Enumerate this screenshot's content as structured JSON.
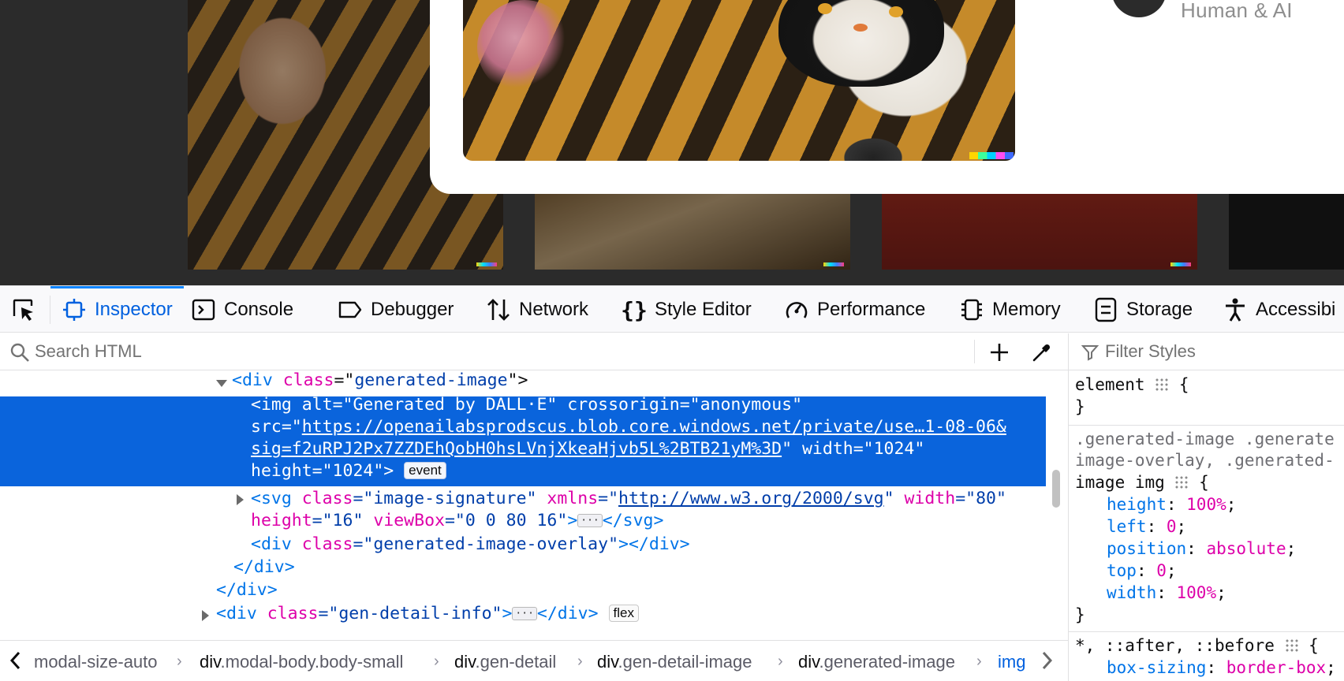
{
  "page": {
    "modal_credit": "Human & AI"
  },
  "devtools": {
    "tabs": [
      {
        "label": "Inspector",
        "icon": "inspector-icon"
      },
      {
        "label": "Console",
        "icon": "console-icon"
      },
      {
        "label": "Debugger",
        "icon": "debugger-icon"
      },
      {
        "label": "Network",
        "icon": "network-icon"
      },
      {
        "label": "Style Editor",
        "icon": "style-editor-icon"
      },
      {
        "label": "Performance",
        "icon": "performance-icon"
      },
      {
        "label": "Memory",
        "icon": "memory-icon"
      },
      {
        "label": "Storage",
        "icon": "storage-icon"
      },
      {
        "label": "Accessibi",
        "icon": "accessibility-icon"
      }
    ],
    "active_tab": "Inspector",
    "search_placeholder": "Search HTML",
    "filter_placeholder": "Filter Styles",
    "markup": {
      "line1": {
        "tag_open": "<div",
        "attr": "class",
        "eq": "=\"",
        "val": "generated-image",
        "close": "\">"
      },
      "selected": {
        "l1_a": "<img ",
        "l1_attr1": "alt",
        "l1_val1": "=\"Generated by DALL·E\"",
        "l1_attr2": " crossorigin",
        "l1_val2": "=\"anonymous\"",
        "l2_attr": "src",
        "l2_eq": "=\"",
        "l2_url": "https://openailabsprodscus.blob.core.windows.net/private/use…1-08-06&",
        "l3_url": "sig=f2uRPJ2Px7ZZDEhQobH0hsLVnjXkeaHjvb5L%2BTB21yM%3D",
        "l3_rest": "\" width=\"1024\"",
        "l4": "height=\"1024\">",
        "badge": "event"
      },
      "svg": {
        "open": "<svg ",
        "attr1": "class",
        "val1": "=\"image-signature\"",
        "attr2": " xmlns",
        "val2a": "=\"",
        "url": "http://www.w3.org/2000/svg",
        "val2b": "\"",
        "attr3": " width",
        "val3": "=\"80\""
      },
      "svg2": {
        "attr1": "height",
        "val1": "=\"16\"",
        "attr2": " viewBox",
        "val2": "=\"0 0 80 16\"",
        "close": ">",
        "end": "</svg>"
      },
      "overlay": {
        "open": "<div ",
        "attr": "class",
        "val": "=\"generated-image-overlay\"",
        "close": "></div>"
      },
      "close_div1": "</div>",
      "close_div2": "</div>",
      "gen_detail": {
        "open": "<div ",
        "attr": "class",
        "val": "=\"gen-detail-info\"",
        "close": ">",
        "end": "</div>",
        "badge": "flex"
      }
    },
    "breadcrumb": [
      {
        "tag": "",
        "cls": "modal-size-auto"
      },
      {
        "tag": "div",
        "cls": ".modal-body.body-small"
      },
      {
        "tag": "div",
        "cls": ".gen-detail"
      },
      {
        "tag": "div",
        "cls": ".gen-detail-image"
      },
      {
        "tag": "div",
        "cls": ".generated-image"
      },
      {
        "tag": "img",
        "cls": ""
      }
    ],
    "rules": {
      "element": {
        "selector": "element",
        "brace_open": " {",
        "brace_close": "}"
      },
      "r2": {
        "sel1": ".generated-image .generate",
        "sel2": "image-overlay, .generated-",
        "sel3": "image img",
        "props": [
          {
            "name": "height",
            "value": "100%"
          },
          {
            "name": "left",
            "value": "0"
          },
          {
            "name": "position",
            "value": "absolute"
          },
          {
            "name": "top",
            "value": "0"
          },
          {
            "name": "width",
            "value": "100%"
          }
        ],
        "close": "}"
      },
      "r3": {
        "selector": "*, ::after, ::before",
        "prop": "box-sizing",
        "value": "border-box"
      }
    }
  }
}
